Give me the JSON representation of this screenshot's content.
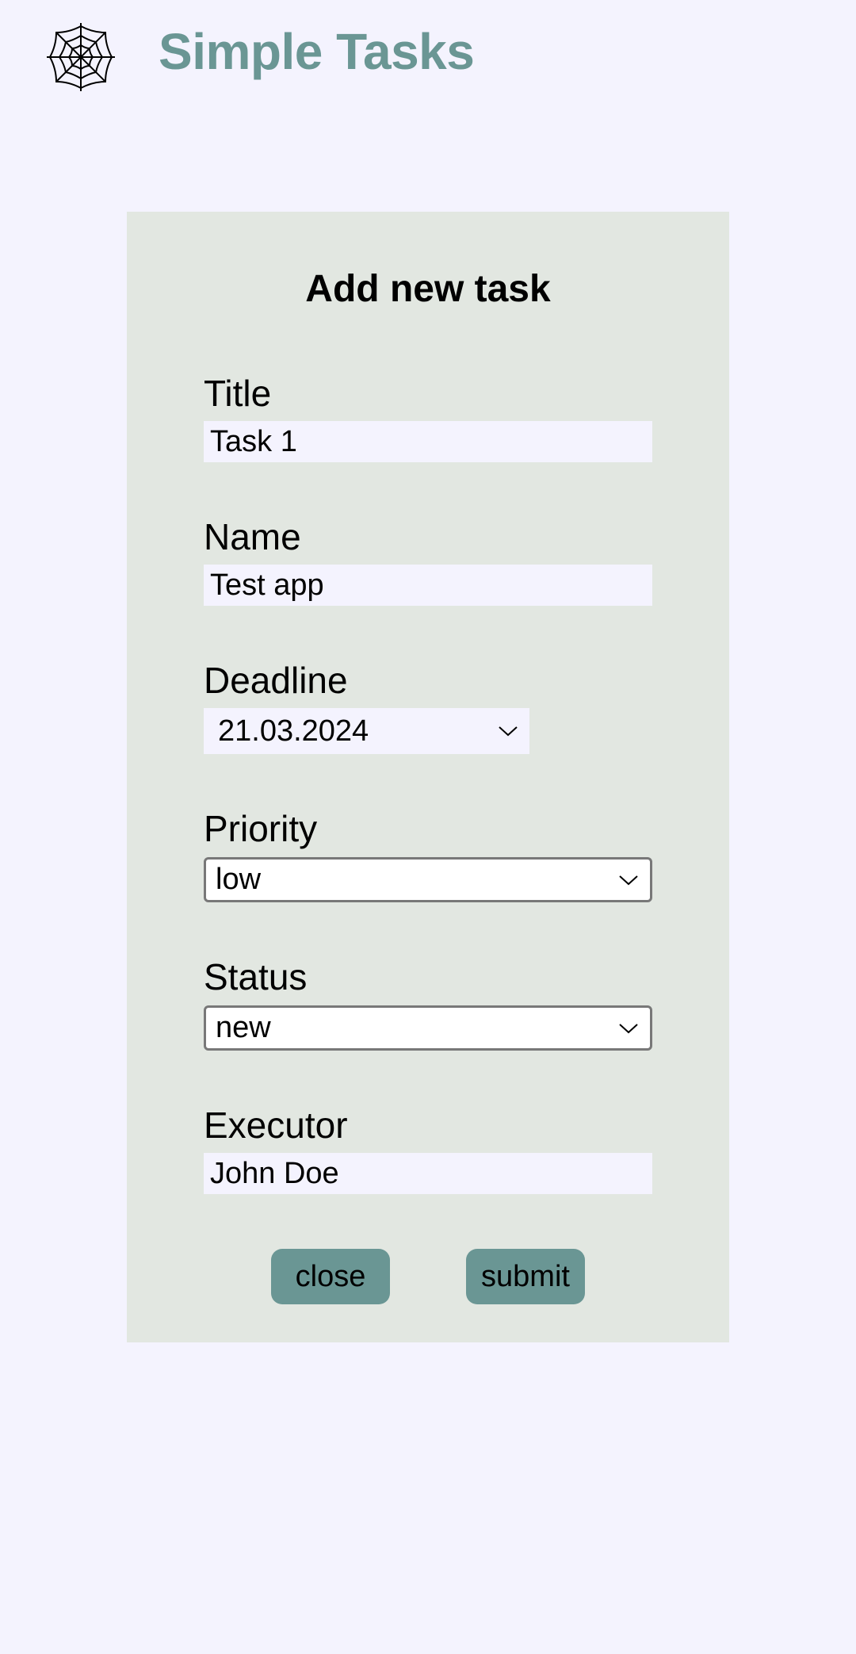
{
  "header": {
    "app_title": "Simple Tasks",
    "logo_icon": "spider-web-icon"
  },
  "form": {
    "title": "Add new task",
    "fields": {
      "title": {
        "label": "Title",
        "value": "Task 1"
      },
      "name": {
        "label": "Name",
        "value": "Test app"
      },
      "deadline": {
        "label": "Deadline",
        "value": "21.03.2024"
      },
      "priority": {
        "label": "Priority",
        "value": "low"
      },
      "status": {
        "label": "Status",
        "value": "new"
      },
      "executor": {
        "label": "Executor",
        "value": "John Doe"
      }
    },
    "buttons": {
      "close": "close",
      "submit": "submit"
    }
  },
  "colors": {
    "accent": "#6a9694",
    "background": "#f4f3fe",
    "card": "#e2e7e1"
  }
}
